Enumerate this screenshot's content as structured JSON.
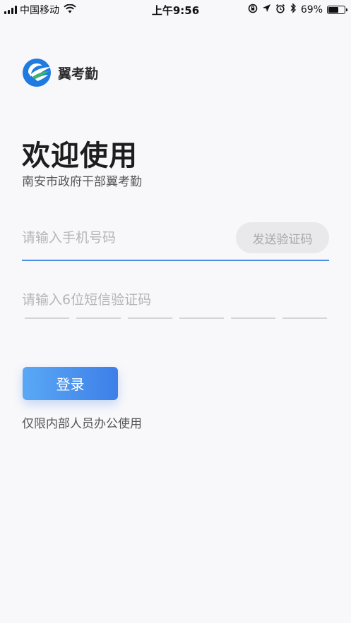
{
  "status_bar": {
    "carrier": "中国移动",
    "time": "上午9:56",
    "battery_percent": "69%",
    "battery_level": 0.69
  },
  "app": {
    "logo_icon": "wing-logo-icon",
    "name": "翼考勤"
  },
  "welcome": {
    "title": "欢迎使用",
    "subtitle": "南安市政府干部翼考勤"
  },
  "form": {
    "phone_placeholder": "请输入手机号码",
    "phone_value": "",
    "send_code_label": "发送验证码",
    "code_placeholder": "请输入6位短信验证码",
    "code_slots": [
      "",
      "",
      "",
      "",
      "",
      ""
    ]
  },
  "login": {
    "button_label": "登录",
    "note": "仅限内部人员办公使用"
  },
  "colors": {
    "accent": "#3d7fe8",
    "input_underline": "#4a8ee6",
    "disabled_button": "#e9e9eb"
  }
}
